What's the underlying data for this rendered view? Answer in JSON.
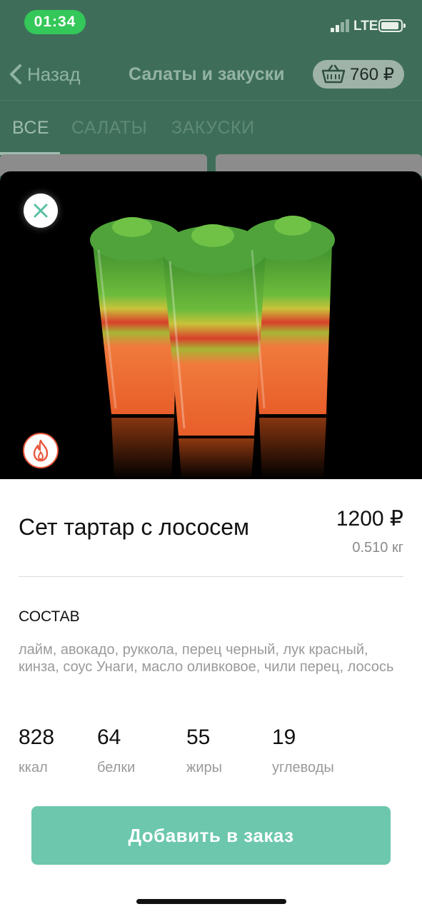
{
  "status_bar": {
    "time": "01:34",
    "network": "LTE"
  },
  "nav": {
    "back_label": "Назад",
    "title": "Салаты и закуски",
    "cart_total": "760 ₽"
  },
  "tabs": [
    {
      "label": "ВСЕ",
      "active": true
    },
    {
      "label": "САЛАТЫ",
      "active": false
    },
    {
      "label": "ЗАКУСКИ",
      "active": false
    }
  ],
  "product": {
    "name": "Сет тартар с лососем",
    "price": "1200 ₽",
    "weight": "0.510 кг",
    "composition_title": "СОСТАВ",
    "ingredients": "лайм, авокадо, руккола, перец черный, лук красный, кинза, соус Унаги, масло оливковое, чили перец, лосось",
    "nutrition": [
      {
        "value": "828",
        "label": "ккал"
      },
      {
        "value": "64",
        "label": "белки"
      },
      {
        "value": "55",
        "label": "жиры"
      },
      {
        "value": "19",
        "label": "углеводы"
      }
    ],
    "badge_icon": "fire-icon"
  },
  "actions": {
    "add_label": "Добавить в заказ"
  },
  "colors": {
    "accent": "#6cc7ad",
    "header_bg": "#3e6e59",
    "badge": "#e8563b"
  }
}
